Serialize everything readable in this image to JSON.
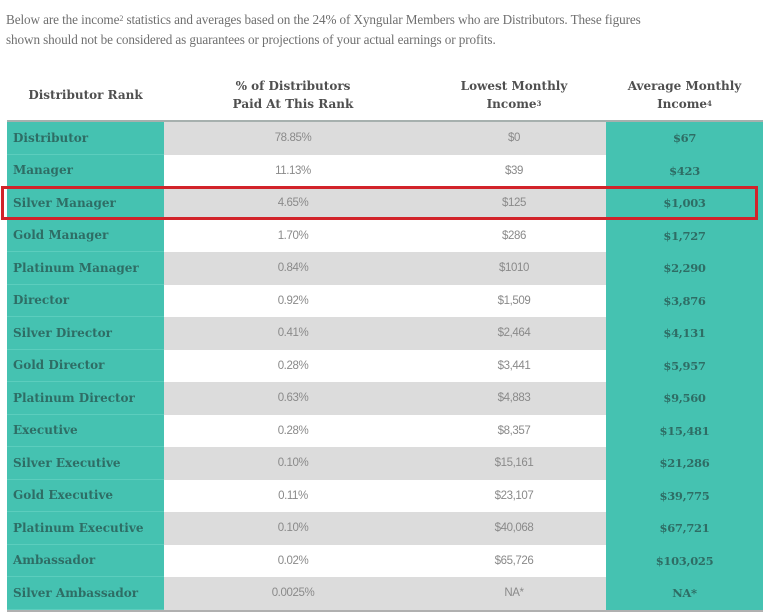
{
  "intro": {
    "line1_a": "Below are the income",
    "line1_sup": "2",
    "line1_b": " statistics and averages based on the 24% of Xyngular Members who are Distributors. These figures",
    "line2": "shown should not be considered as guarantees or projections of your actual earnings or profits."
  },
  "table": {
    "headers": {
      "rank": "Distributor Rank",
      "percent_l1": "% of Distributors",
      "percent_l2": "Paid At This Rank",
      "lowest_l1": "Lowest Monthly",
      "lowest_l2": "Income",
      "lowest_sup": "3",
      "average_l1": "Average Monthly",
      "average_l2": "Income",
      "average_sup": "4"
    },
    "rows": [
      {
        "rank": "Distributor",
        "percent": "78.85%",
        "lowest": "$0",
        "average": "$67"
      },
      {
        "rank": "Manager",
        "percent": "11.13%",
        "lowest": "$39",
        "average": "$423"
      },
      {
        "rank": "Silver Manager",
        "percent": "4.65%",
        "lowest": "$125",
        "average": "$1,003"
      },
      {
        "rank": "Gold Manager",
        "percent": "1.70%",
        "lowest": "$286",
        "average": "$1,727"
      },
      {
        "rank": "Platinum Manager",
        "percent": "0.84%",
        "lowest": "$1010",
        "average": "$2,290"
      },
      {
        "rank": "Director",
        "percent": "0.92%",
        "lowest": "$1,509",
        "average": "$3,876"
      },
      {
        "rank": "Silver Director",
        "percent": "0.41%",
        "lowest": "$2,464",
        "average": "$4,131"
      },
      {
        "rank": "Gold Director",
        "percent": "0.28%",
        "lowest": "$3,441",
        "average": "$5,957"
      },
      {
        "rank": "Platinum Director",
        "percent": "0.63%",
        "lowest": "$4,883",
        "average": "$9,560"
      },
      {
        "rank": "Executive",
        "percent": "0.28%",
        "lowest": "$8,357",
        "average": "$15,481"
      },
      {
        "rank": "Silver Executive",
        "percent": "0.10%",
        "lowest": "$15,161",
        "average": "$21,286"
      },
      {
        "rank": "Gold Executive",
        "percent": "0.11%",
        "lowest": "$23,107",
        "average": "$39,775"
      },
      {
        "rank": "Platinum Executive",
        "percent": "0.10%",
        "lowest": "$40,068",
        "average": "$67,721"
      },
      {
        "rank": "Ambassador",
        "percent": "0.02%",
        "lowest": "$65,726",
        "average": "$103,025"
      },
      {
        "rank": "Silver Ambassador",
        "percent": "0.0025%",
        "lowest": "NA*",
        "average": "NA*"
      }
    ],
    "highlighted_row": "Silver Manager"
  },
  "colors": {
    "teal": "#45c2b1",
    "teal_text": "#2e6d65",
    "stripe_gray": "#dcdcdc",
    "highlight_red": "#d2232a"
  }
}
